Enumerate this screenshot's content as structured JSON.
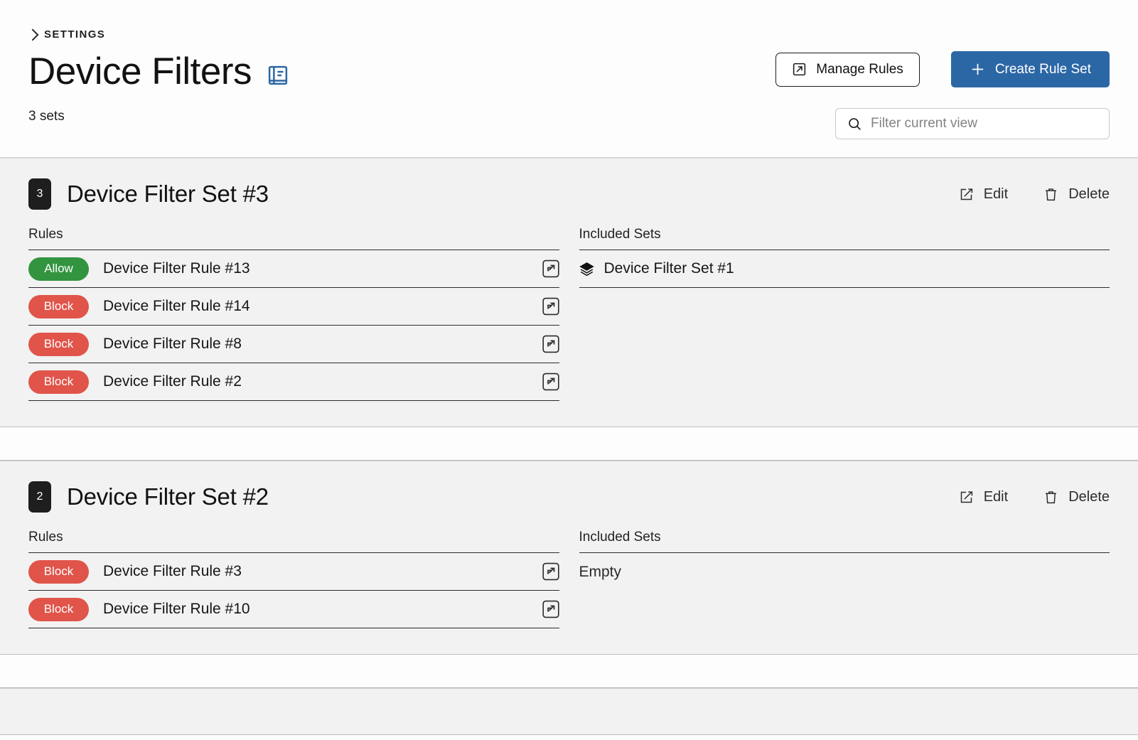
{
  "header": {
    "breadcrumb": "SETTINGS",
    "title": "Device Filters",
    "title_icon": "book-icon",
    "subtitle": "3 sets",
    "manage_rules_label": "Manage Rules",
    "manage_rules_icon": "arrow-up-right-box-icon",
    "create_rule_set_label": "Create Rule Set",
    "create_rule_set_icon": "plus-icon",
    "accent_color": "#2c67a5"
  },
  "search": {
    "placeholder": "Filter current view",
    "value": "",
    "icon": "search-icon"
  },
  "labels": {
    "rules": "Rules",
    "included_sets": "Included Sets",
    "edit": "Edit",
    "delete": "Delete",
    "empty": "Empty",
    "edit_icon": "pencil-square-icon",
    "delete_icon": "trash-icon",
    "expand_icon": "expand-box-icon",
    "included_set_icon": "layers-icon"
  },
  "colors": {
    "allow": "#339440",
    "block": "#e0544a",
    "badge": "#1e1e1e",
    "section_bg": "#f2f2f2",
    "page_bg": "#fdfdfd"
  },
  "sets": [
    {
      "badge": "3",
      "name": "Device Filter Set #3",
      "rules": [
        {
          "action": "Allow",
          "name": "Device Filter Rule #13"
        },
        {
          "action": "Block",
          "name": "Device Filter Rule #14"
        },
        {
          "action": "Block",
          "name": "Device Filter Rule #8"
        },
        {
          "action": "Block",
          "name": "Device Filter Rule #2"
        }
      ],
      "included_sets": [
        "Device Filter Set #1"
      ]
    },
    {
      "badge": "2",
      "name": "Device Filter Set #2",
      "rules": [
        {
          "action": "Block",
          "name": "Device Filter Rule #3"
        },
        {
          "action": "Block",
          "name": "Device Filter Rule #10"
        }
      ],
      "included_sets": []
    }
  ]
}
